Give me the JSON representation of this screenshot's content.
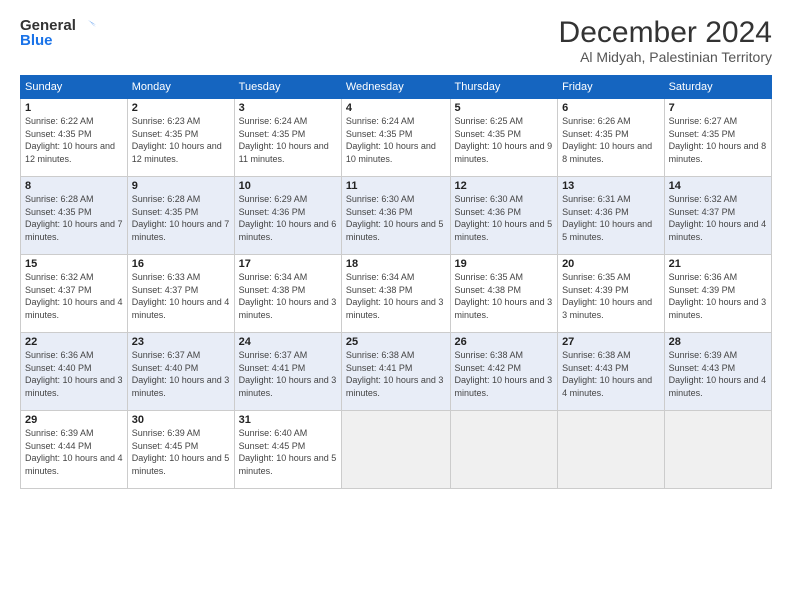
{
  "header": {
    "logo_line1": "General",
    "logo_line2": "Blue",
    "month_title": "December 2024",
    "location": "Al Midyah, Palestinian Territory"
  },
  "days_of_week": [
    "Sunday",
    "Monday",
    "Tuesday",
    "Wednesday",
    "Thursday",
    "Friday",
    "Saturday"
  ],
  "weeks": [
    [
      {
        "num": "1",
        "sunrise": "6:22 AM",
        "sunset": "4:35 PM",
        "daylight": "10 hours and 12 minutes."
      },
      {
        "num": "2",
        "sunrise": "6:23 AM",
        "sunset": "4:35 PM",
        "daylight": "10 hours and 12 minutes."
      },
      {
        "num": "3",
        "sunrise": "6:24 AM",
        "sunset": "4:35 PM",
        "daylight": "10 hours and 11 minutes."
      },
      {
        "num": "4",
        "sunrise": "6:24 AM",
        "sunset": "4:35 PM",
        "daylight": "10 hours and 10 minutes."
      },
      {
        "num": "5",
        "sunrise": "6:25 AM",
        "sunset": "4:35 PM",
        "daylight": "10 hours and 9 minutes."
      },
      {
        "num": "6",
        "sunrise": "6:26 AM",
        "sunset": "4:35 PM",
        "daylight": "10 hours and 8 minutes."
      },
      {
        "num": "7",
        "sunrise": "6:27 AM",
        "sunset": "4:35 PM",
        "daylight": "10 hours and 8 minutes."
      }
    ],
    [
      {
        "num": "8",
        "sunrise": "6:28 AM",
        "sunset": "4:35 PM",
        "daylight": "10 hours and 7 minutes."
      },
      {
        "num": "9",
        "sunrise": "6:28 AM",
        "sunset": "4:35 PM",
        "daylight": "10 hours and 7 minutes."
      },
      {
        "num": "10",
        "sunrise": "6:29 AM",
        "sunset": "4:36 PM",
        "daylight": "10 hours and 6 minutes."
      },
      {
        "num": "11",
        "sunrise": "6:30 AM",
        "sunset": "4:36 PM",
        "daylight": "10 hours and 5 minutes."
      },
      {
        "num": "12",
        "sunrise": "6:30 AM",
        "sunset": "4:36 PM",
        "daylight": "10 hours and 5 minutes."
      },
      {
        "num": "13",
        "sunrise": "6:31 AM",
        "sunset": "4:36 PM",
        "daylight": "10 hours and 5 minutes."
      },
      {
        "num": "14",
        "sunrise": "6:32 AM",
        "sunset": "4:37 PM",
        "daylight": "10 hours and 4 minutes."
      }
    ],
    [
      {
        "num": "15",
        "sunrise": "6:32 AM",
        "sunset": "4:37 PM",
        "daylight": "10 hours and 4 minutes."
      },
      {
        "num": "16",
        "sunrise": "6:33 AM",
        "sunset": "4:37 PM",
        "daylight": "10 hours and 4 minutes."
      },
      {
        "num": "17",
        "sunrise": "6:34 AM",
        "sunset": "4:38 PM",
        "daylight": "10 hours and 3 minutes."
      },
      {
        "num": "18",
        "sunrise": "6:34 AM",
        "sunset": "4:38 PM",
        "daylight": "10 hours and 3 minutes."
      },
      {
        "num": "19",
        "sunrise": "6:35 AM",
        "sunset": "4:38 PM",
        "daylight": "10 hours and 3 minutes."
      },
      {
        "num": "20",
        "sunrise": "6:35 AM",
        "sunset": "4:39 PM",
        "daylight": "10 hours and 3 minutes."
      },
      {
        "num": "21",
        "sunrise": "6:36 AM",
        "sunset": "4:39 PM",
        "daylight": "10 hours and 3 minutes."
      }
    ],
    [
      {
        "num": "22",
        "sunrise": "6:36 AM",
        "sunset": "4:40 PM",
        "daylight": "10 hours and 3 minutes."
      },
      {
        "num": "23",
        "sunrise": "6:37 AM",
        "sunset": "4:40 PM",
        "daylight": "10 hours and 3 minutes."
      },
      {
        "num": "24",
        "sunrise": "6:37 AM",
        "sunset": "4:41 PM",
        "daylight": "10 hours and 3 minutes."
      },
      {
        "num": "25",
        "sunrise": "6:38 AM",
        "sunset": "4:41 PM",
        "daylight": "10 hours and 3 minutes."
      },
      {
        "num": "26",
        "sunrise": "6:38 AM",
        "sunset": "4:42 PM",
        "daylight": "10 hours and 3 minutes."
      },
      {
        "num": "27",
        "sunrise": "6:38 AM",
        "sunset": "4:43 PM",
        "daylight": "10 hours and 4 minutes."
      },
      {
        "num": "28",
        "sunrise": "6:39 AM",
        "sunset": "4:43 PM",
        "daylight": "10 hours and 4 minutes."
      }
    ],
    [
      {
        "num": "29",
        "sunrise": "6:39 AM",
        "sunset": "4:44 PM",
        "daylight": "10 hours and 4 minutes."
      },
      {
        "num": "30",
        "sunrise": "6:39 AM",
        "sunset": "4:45 PM",
        "daylight": "10 hours and 5 minutes."
      },
      {
        "num": "31",
        "sunrise": "6:40 AM",
        "sunset": "4:45 PM",
        "daylight": "10 hours and 5 minutes."
      },
      null,
      null,
      null,
      null
    ]
  ],
  "labels": {
    "sunrise": "Sunrise:",
    "sunset": "Sunset:",
    "daylight": "Daylight:"
  }
}
